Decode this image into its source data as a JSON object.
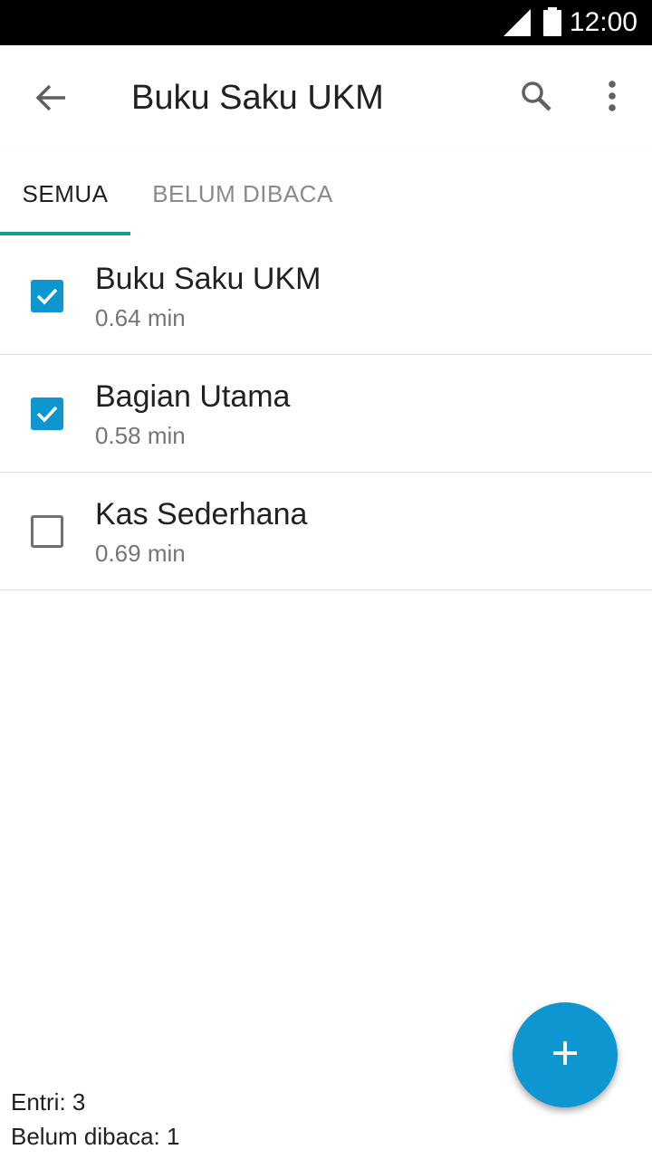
{
  "status_bar": {
    "time": "12:00",
    "icons": [
      "signal-icon",
      "battery-icon"
    ]
  },
  "app_bar": {
    "title": "Buku Saku UKM",
    "icons": [
      "back-arrow-icon",
      "search-icon",
      "more-vert-icon"
    ]
  },
  "tabs": [
    {
      "label": "SEMUA",
      "selected": true
    },
    {
      "label": "BELUM DIBACA",
      "selected": false
    }
  ],
  "list": {
    "items": [
      {
        "title": "Buku Saku UKM",
        "meta": "0.64 min",
        "checked": true
      },
      {
        "title": "Bagian Utama",
        "meta": "0.58 min",
        "checked": true
      },
      {
        "title": "Kas Sederhana",
        "meta": "0.69 min",
        "checked": false
      }
    ]
  },
  "footer": {
    "entries_label": "Entri: 3",
    "unread_label": "Belum dibaca: 1"
  },
  "fab": {
    "icon": "plus-icon"
  },
  "colors": {
    "accent": "#0d96d0",
    "tab_indicator": "#1a9e8c",
    "text_primary": "#212121",
    "text_secondary": "#757575"
  }
}
